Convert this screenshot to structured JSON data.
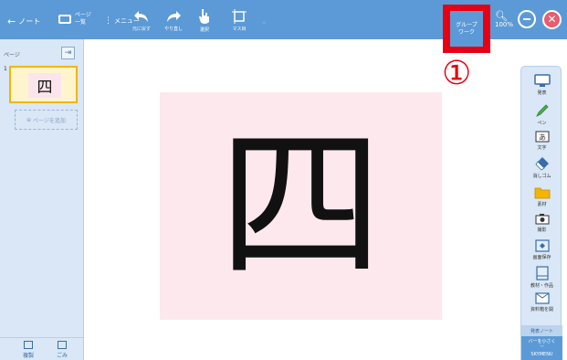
{
  "toolbar": {
    "back_label": "ノート",
    "pages_label_line1": "ページ",
    "pages_label_line2": "一覧",
    "menu_label": "メニュー",
    "undo_label": "元に戻す",
    "redo_label": "やり直し",
    "select_label": "選択",
    "grid_label": "マス目",
    "groupwork_line1": "グループ",
    "groupwork_line2": "ワーク",
    "zoom_value": "100%"
  },
  "left_panel": {
    "header": "ページ",
    "thumbnail_number": "1",
    "thumbnail_char": "四",
    "add_page_label": "ページを追加",
    "copy_label": "複製",
    "paste_label": "ごみ"
  },
  "canvas": {
    "character": "四"
  },
  "annotation": {
    "marker": "①",
    "color": "#e60012"
  },
  "right_panel": {
    "tools": [
      {
        "label": "発表",
        "icon": "presentation-icon"
      },
      {
        "label": "ペン",
        "icon": "pen-icon"
      },
      {
        "label": "文字",
        "icon": "text-icon"
      },
      {
        "label": "消しゴム",
        "icon": "eraser-icon"
      },
      {
        "label": "素材",
        "icon": "folder-icon"
      },
      {
        "label": "撮影",
        "icon": "camera-icon"
      },
      {
        "label": "画面保存",
        "icon": "save-screen-icon"
      },
      {
        "label": "教材・作品",
        "icon": "works-icon"
      },
      {
        "label": "資料箱を開",
        "icon": "materials-box-icon"
      }
    ],
    "note_label": "発表ノート",
    "brand_line1": "バーを小さく",
    "brand_line2": "SKYMENU"
  },
  "colors": {
    "toolbar": "#5b9ad6",
    "panel": "#d9e7f6",
    "canvas": "#fde8ed",
    "highlight": "#e60012",
    "thumbnail_border": "#f5b400"
  }
}
